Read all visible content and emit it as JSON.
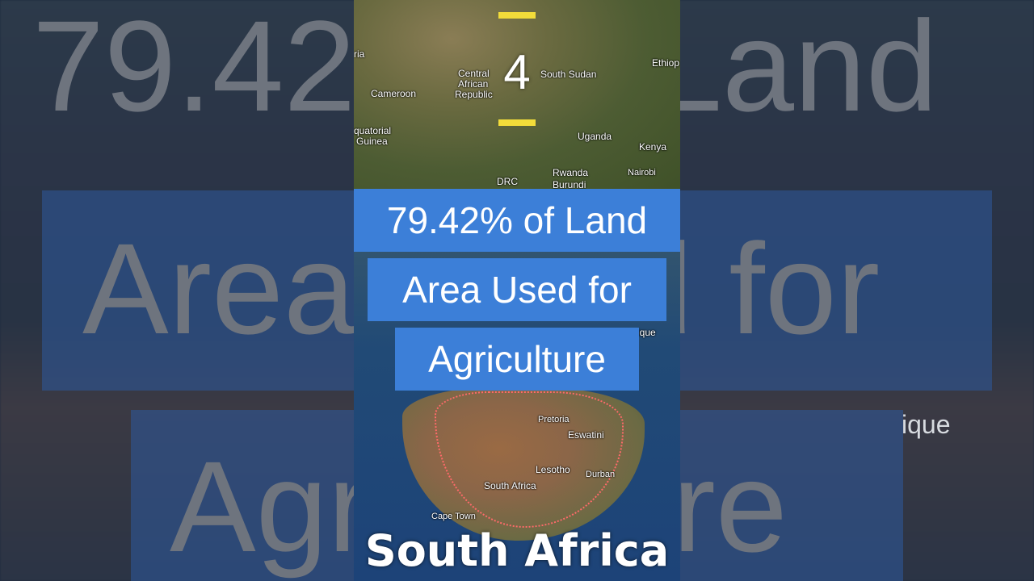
{
  "rank": "4",
  "caption": {
    "line1": "79.42% of Land",
    "line2": "Area Used for",
    "line3": "Agriculture"
  },
  "country": "South Africa",
  "map_labels": {
    "cameroon": "Cameroon",
    "car_1": "Central",
    "car_2": "African",
    "car_3": "Republic",
    "south_sudan": "South Sudan",
    "ethiopia": "Ethiop",
    "nigeria": "ria",
    "eq_guinea_1": "quatorial",
    "eq_guinea_2": "Guinea",
    "uganda": "Uganda",
    "kenya": "Kenya",
    "drc": "DRC",
    "rwanda": "Rwanda",
    "burundi": "Burundi",
    "nairobi": "Nairobi",
    "mozambique": "ique",
    "pretoria": "Pretoria",
    "eswatini": "Eswatini",
    "lesotho": "Lesotho",
    "durban": "Durban",
    "south_africa": "South Africa",
    "cape_town": "Cape Town"
  },
  "background_text": {
    "top": "79.42% of Land",
    "middle": "Area Used for",
    "bottom": "Agriculture",
    "mozambique": "ique"
  },
  "colors": {
    "caption_bg": "#3c7fd8",
    "dash": "#f2dc3a",
    "border": "#ff6a6a"
  }
}
